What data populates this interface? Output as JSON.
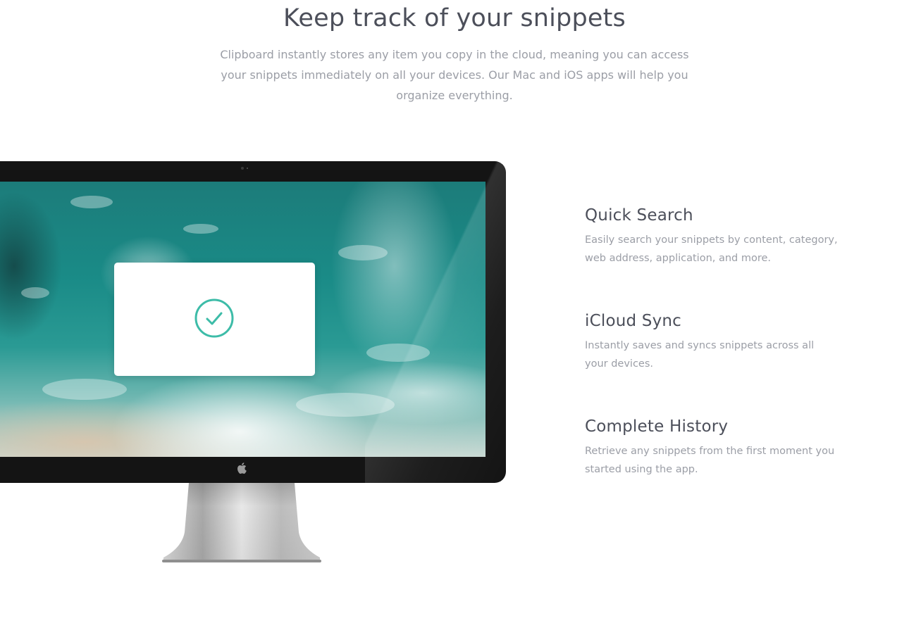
{
  "header": {
    "title": "Keep track of your snippets",
    "description": "Clipboard instantly stores any item you copy in the cloud, meaning you can access your snippets immediately on all your devices. Our Mac and iOS apps will help you organize everything."
  },
  "device": {
    "dialog_icon": "checkmark-circle-icon",
    "accent_color": "#3dbca8"
  },
  "features": [
    {
      "title": "Quick Search",
      "description": "Easily search your snippets by content, category, web address, application, and more."
    },
    {
      "title": "iCloud Sync",
      "description": "Instantly saves and syncs snippets across all your devices."
    },
    {
      "title": "Complete History",
      "description": "Retrieve any snippets from the first moment you started using the app."
    }
  ]
}
